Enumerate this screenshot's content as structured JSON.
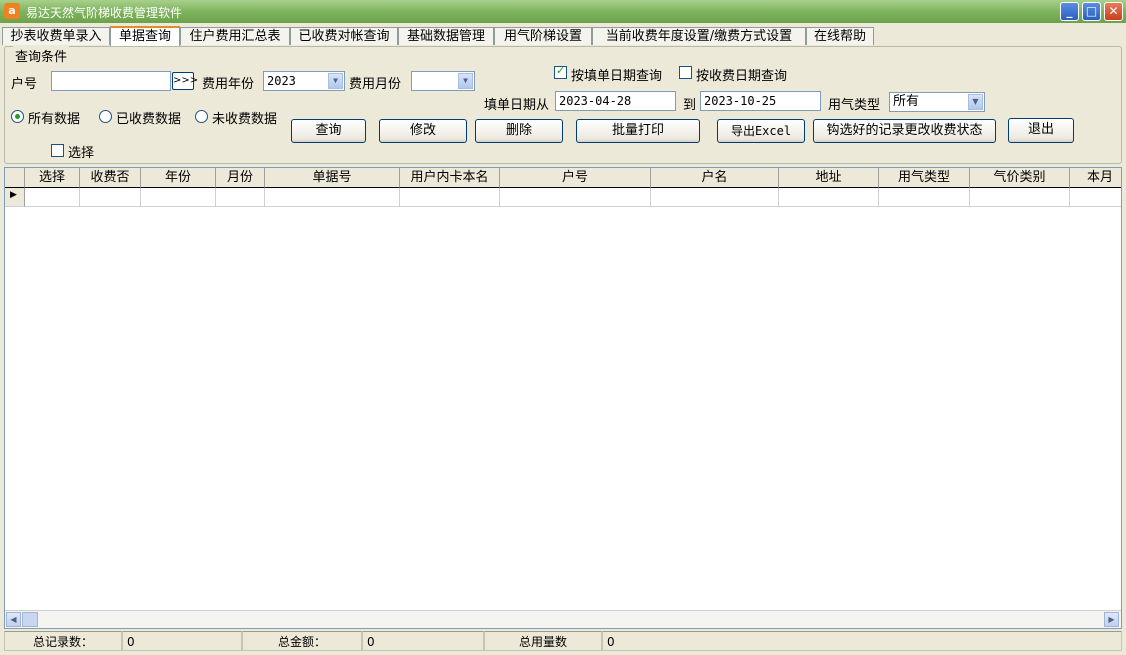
{
  "window": {
    "title": "易达天然气阶梯收费管理软件",
    "app_icon": "a"
  },
  "tabs": [
    {
      "label": "抄表收费单录入"
    },
    {
      "label": "单据查询"
    },
    {
      "label": "住户费用汇总表"
    },
    {
      "label": "已收费对帐查询"
    },
    {
      "label": "基础数据管理"
    },
    {
      "label": "用气阶梯设置"
    },
    {
      "label": "当前收费年度设置/缴费方式设置"
    },
    {
      "label": "在线帮助"
    }
  ],
  "query": {
    "group_label": "查询条件",
    "account_label": "户号",
    "account_value": "",
    "lookup_label": ">>>",
    "fee_year_label": "费用年份",
    "fee_year_value": "2023",
    "fee_month_label": "费用月份",
    "fee_month_value": "",
    "by_fill_date_label": "按填单日期查询",
    "by_pay_date_label": "按收费日期查询",
    "fill_date_from_label": "填单日期从",
    "date_from": "2023-04-28",
    "to_label": "到",
    "date_to": "2023-10-25",
    "gas_type_label": "用气类型",
    "gas_type_value": "所有",
    "radio_all": "所有数据",
    "radio_paid": "已收费数据",
    "radio_unpaid": "未收费数据",
    "select_label": "选择"
  },
  "buttons": {
    "search": "查询",
    "edit": "修改",
    "delete": "删除",
    "batch_print": "批量打印",
    "export": "导出Excel",
    "change_status": "钩选好的记录更改收费状态",
    "exit": "退出"
  },
  "grid": {
    "columns": [
      "选择",
      "收费否",
      "年份",
      "月份",
      "单据号",
      "用户内卡本名",
      "户号",
      "户名",
      "地址",
      "用气类型",
      "气价类别",
      "本月"
    ]
  },
  "status": {
    "total_records_label": "总记录数：",
    "total_records": "0",
    "total_amount_label": "总金额：",
    "total_amount": "0",
    "total_usage_label": "总用量数",
    "total_usage": "0"
  }
}
